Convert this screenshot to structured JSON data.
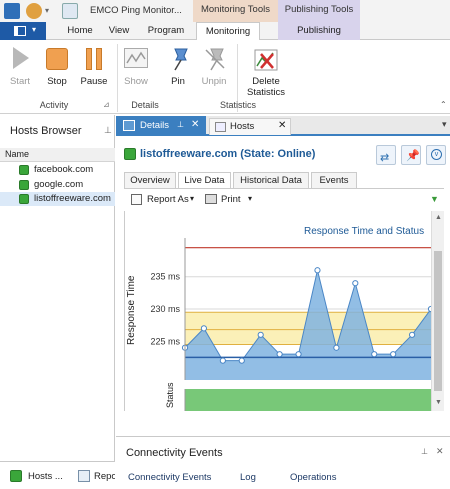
{
  "window": {
    "title": "EMCO Ping Monitor..."
  },
  "contextual_tabs": {
    "monitoring": "Monitoring Tools",
    "publishing": "Publishing Tools"
  },
  "ribbon_tabs": [
    "Home",
    "View",
    "Program",
    "Monitoring",
    "Publishing"
  ],
  "ribbon": {
    "start": "Start",
    "stop": "Stop",
    "pause": "Pause",
    "show": "Show",
    "pin": "Pin",
    "unpin": "Unpin",
    "delete_stats_1": "Delete",
    "delete_stats_2": "Statistics",
    "groups": {
      "activity": "Activity",
      "details": "Details",
      "statistics": "Statistics"
    }
  },
  "hosts_browser": {
    "title": "Hosts Browser",
    "column": "Name",
    "hosts": [
      "facebook.com",
      "google.com",
      "listoffreeware.com"
    ],
    "bottom_tabs": [
      "Hosts ...",
      "Repo"
    ]
  },
  "doc_tabs": {
    "details": "Details",
    "hosts": "Hosts"
  },
  "details": {
    "headline": "listoffreeware.com (State: Online)",
    "inner_tabs": [
      "Overview",
      "Live Data",
      "Historical Data",
      "Events"
    ],
    "toolbar": {
      "report": "Report As",
      "print": "Print"
    }
  },
  "chart_data": {
    "type": "area",
    "title": "Response Time and Status",
    "ylabel": "Response Time",
    "status_label": "Status",
    "y_ticks": [
      "235 ms",
      "230 ms",
      "225 ms"
    ],
    "y_tick_values": [
      235,
      230,
      225
    ],
    "ylim": [
      219,
      241
    ],
    "x": [
      1,
      2,
      3,
      4,
      5,
      6,
      7,
      8,
      9,
      10,
      11,
      12,
      13,
      14
    ],
    "values": [
      224,
      227,
      222,
      222,
      226,
      223,
      223,
      236,
      224,
      234,
      223,
      223,
      226,
      230
    ],
    "reference_lines": {
      "max_red": 239.5,
      "avg_band_low": 224.5,
      "avg_band_high": 229.5,
      "avg_line": 226.8,
      "min_line": 222.5
    },
    "colors": {
      "area": "#7fb3e0",
      "line": "#4a86c6",
      "band": "#fbeeb0",
      "max": "#c0392b",
      "status": "#78c878"
    }
  },
  "connectivity": {
    "title": "Connectivity Events",
    "tabs": [
      "Connectivity Events",
      "Log",
      "Operations"
    ]
  }
}
